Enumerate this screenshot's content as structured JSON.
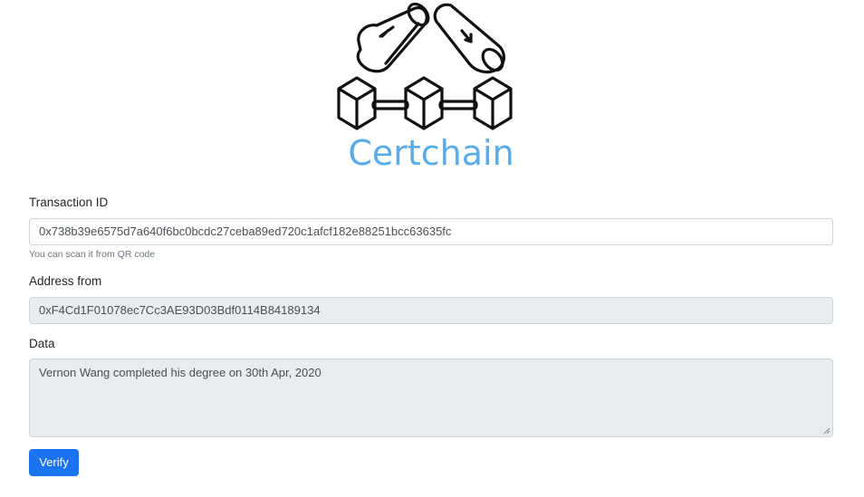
{
  "brand": {
    "logo_icon": "blockchain-icon",
    "name": "Certchain",
    "color": "#5aabea"
  },
  "form": {
    "transaction_id": {
      "label": "Transaction ID",
      "value": "0x738b39e6575d7a640f6bc0bcdc27ceba89ed720c1afcf182e88251bcc63635fc",
      "help": "You can scan it from QR code"
    },
    "address_from": {
      "label": "Address from",
      "value": "0xF4Cd1F01078ec7Cc3AE93D03Bdf0114B84189134"
    },
    "data": {
      "label": "Data",
      "value": "Vernon Wang completed his degree on 30th Apr, 2020"
    },
    "verify_label": "Verify",
    "accent_color": "#1a73f0"
  }
}
